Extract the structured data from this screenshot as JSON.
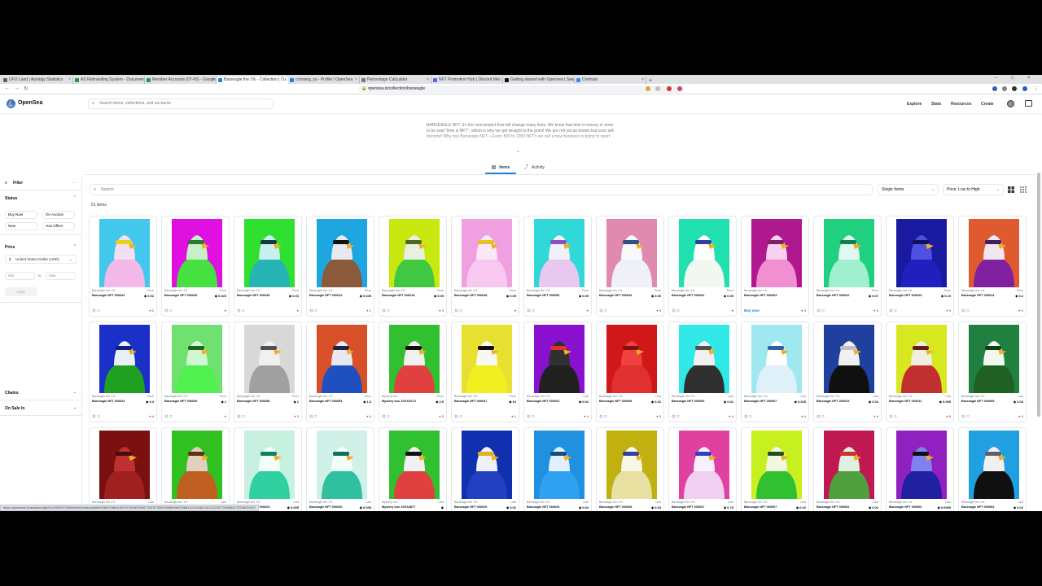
{
  "browser": {
    "tabs": [
      {
        "label": "UFO Land | Apology Statistics",
        "fav": "#5f6368"
      },
      {
        "label": "AS Rebranding System - Documentati...",
        "fav": "#3c8e3c"
      },
      {
        "label": "Member Accounts (07-#5) - Google ...",
        "fav": "#0f9d58"
      },
      {
        "label": "Barseagle the 1% - Collection | O...",
        "fav": "#2081e2",
        "active": true
      },
      {
        "label": "crossing_xx - Profile | OpenSea",
        "fav": "#2081e2"
      },
      {
        "label": "Percentage Calculator",
        "fav": "#777777"
      },
      {
        "label": "NFT Promotion Hub | Discord Me...",
        "fav": "#5865f2"
      },
      {
        "label": "Getting started with Opensea | Sea...",
        "fav": "#111111"
      },
      {
        "label": "Contrast",
        "fav": "#4285f4"
      }
    ],
    "new_tab": "+",
    "url": "opensea.io/collection/barseagle",
    "status_url": "https://opensea.io/assets/matic/0x2953397248fcbb4fe0cbaca8a0fcf0384f7486b1/557572648735617281573592389806980786814231638218121133077540680175756229017"
  },
  "header": {
    "logo": "OpenSea",
    "search_placeholder": "Search items, collections, and accounts",
    "nav": [
      "Explore",
      "Stats",
      "Resources",
      "Create"
    ]
  },
  "collection": {
    "description": "BARSEAGLE NFT, it's the next project that will change many lives. We know that time is money or soon to be said \"time is NFT\", which is why we get straight to the point! We are not yet as known but soon will become! Why buy Barseagle NFT: • Every 500 to 1000 NFT's we sell a new business is going to open! Let the future it down, let's say you want to open your own business, if you",
    "expand": "⌄"
  },
  "view_tabs": {
    "items": "Items",
    "activity": "Activity"
  },
  "sidebar": {
    "filter": "Filter",
    "collapse": "←",
    "status": "Status",
    "status_chips": [
      "Buy Now",
      "On Auction",
      "New",
      "Has Offers"
    ],
    "price": "Price",
    "currency": "United States Dollar (USD)",
    "min": "Min",
    "to": "to",
    "max": "Max",
    "apply": "Apply",
    "chains": "Chains",
    "on_sale_in": "On Sale In"
  },
  "toolbar": {
    "search_placeholder": "Search",
    "single_items": "Single Items",
    "sort": "Price: Low to High",
    "count": "51 items"
  },
  "cards": [
    {
      "name": "Barseagle the 1%",
      "token": "Barseagle NFT 000042",
      "plabel": "Price",
      "price": "0.02",
      "favs": "2",
      "bg": "#42c8ec",
      "body": "#f2b8e8",
      "head": "#f0e0f0",
      "accent": "#e8d020"
    },
    {
      "name": "Barseagle the 1%",
      "token": "Barseagle NFT 000046",
      "plabel": "Price",
      "price": "0.025",
      "favs": "",
      "bg": "#e010e0",
      "body": "#46e040",
      "head": "#c8f0c8",
      "accent": "#2a7a2a"
    },
    {
      "name": "Barseagle the 1%",
      "token": "Barseagle NFT 000045",
      "plabel": "Price",
      "price": "0.03",
      "favs": "",
      "bg": "#30e030",
      "body": "#26b4b4",
      "head": "#c8f0f0",
      "accent": "#1a3a3a"
    },
    {
      "name": "Barseagle the 1%",
      "token": "Barseagle NFT 000012",
      "plabel": "Price",
      "price": "0.045",
      "favs": "1",
      "bg": "#1ea6e0",
      "body": "#8a5a3a",
      "head": "#e8e8f0",
      "accent": "#111111"
    },
    {
      "name": "Barseagle the 1%",
      "token": "Barseagle NFT 000018",
      "plabel": "Price",
      "price": "0.05",
      "favs": "3",
      "bg": "#c8e810",
      "body": "#40c840",
      "head": "#e8f0e0",
      "accent": "#4a6a20"
    },
    {
      "name": "Barseagle the 1%",
      "token": "Barseagle NFT 000048",
      "plabel": "Price",
      "price": "0.05",
      "favs": "",
      "bg": "#f0a0e0",
      "body": "#f8c8f0",
      "head": "#f8e8f8",
      "accent": "#e8c020"
    },
    {
      "name": "Barseagle the 1%",
      "token": "Barseagle NFT 000050",
      "plabel": "Price",
      "price": "0.05",
      "favs": "",
      "bg": "#30d8d8",
      "body": "#e8c8f0",
      "head": "#f0f0f8",
      "accent": "#8a50c0"
    },
    {
      "name": "Barseagle the 1%",
      "token": "Barseagle NFT 000049",
      "plabel": "Price",
      "price": "0.05",
      "favs": "3",
      "bg": "#e08ab0",
      "body": "#f0f0f8",
      "head": "#f8f8ff",
      "accent": "#305080"
    },
    {
      "name": "Barseagle the 1%",
      "token": "Barseagle NFT 000051",
      "plabel": "Price",
      "price": "0.05",
      "favs": "",
      "bg": "#20e0b0",
      "body": "#f0f8f0",
      "head": "#ffffff",
      "accent": "#3040a0"
    },
    {
      "name": "Barseagle the 1%",
      "token": "Barseagle NFT 000003",
      "plabel": "",
      "price": "",
      "favs": "3",
      "bg": "#b01890",
      "body": "#f090d0",
      "head": "#f8d0f0",
      "accent": "#802060",
      "buy": "Buy now"
    },
    {
      "name": "Barseagle the 1%",
      "token": "Barseagle NFT 000022",
      "plabel": "Price",
      "price": "0.07",
      "favs": "3",
      "bg": "#20d080",
      "body": "#a0f0d0",
      "head": "#e0f8f0",
      "accent": "#108050"
    },
    {
      "name": "Barseagle the 1%",
      "token": "Barseagle NFT 000023",
      "plabel": "Price",
      "price": "0.19",
      "favs": "3",
      "bg": "#1a1aa0",
      "body": "#2020c0",
      "head": "#5050e0",
      "accent": "#101060"
    },
    {
      "name": "Barseagle the 1%",
      "token": "Barseagle NFT 000014",
      "plabel": "Price",
      "price": "0.2",
      "favs": "4",
      "bg": "#e05a30",
      "body": "#8020a0",
      "head": "#f0e8f0",
      "accent": "#402060"
    },
    {
      "name": "Barseagle the 1%",
      "token": "Barseagle NFT 000023",
      "plabel": "Price",
      "price": "0.3",
      "favs": "4",
      "bg": "#1a30c8",
      "body": "#20a020",
      "head": "#e8f0f8",
      "accent": "#102080"
    },
    {
      "name": "Barseagle the 1%",
      "token": "Barseagle NFT 000006",
      "plabel": "Price",
      "price": "1",
      "favs": "",
      "bg": "#70e070",
      "body": "#50f050",
      "head": "#d0f8d0",
      "accent": "#206020"
    },
    {
      "name": "Barseagle the 1%",
      "token": "Barseagle NFT 000058",
      "plabel": "Price",
      "price": "1",
      "favs": "3",
      "bg": "#d8d8d8",
      "body": "#a0a0a0",
      "head": "#f0f0f0",
      "accent": "#505050"
    },
    {
      "name": "Barseagle the 1%",
      "token": "Barseagle NFT 000053",
      "plabel": "Price",
      "price": "1.3",
      "favs": "4",
      "bg": "#d85028",
      "body": "#2050c0",
      "head": "#e8e8f0",
      "accent": "#202040"
    },
    {
      "name": "Mystery box",
      "token": "Mystery box XX2X2X73",
      "plabel": "Price",
      "price": "2.5",
      "favs": "3",
      "bg": "#30c030",
      "body": "#e04040",
      "head": "#f0f0f0",
      "accent": "#101010"
    },
    {
      "name": "Barseagle the 1%",
      "token": "Barseagle NFT 000047",
      "plabel": "Price",
      "price": "10",
      "favs": "1",
      "bg": "#e8e030",
      "body": "#f0f020",
      "head": "#f8f8f0",
      "accent": "#101010"
    },
    {
      "name": "Barseagle the 1%",
      "token": "Barseagle NFT 000002",
      "plabel": "Last",
      "price": "0.02",
      "favs": "4",
      "bg": "#8a10d0",
      "body": "#202020",
      "head": "#303030",
      "accent": "#e03030"
    },
    {
      "name": "Barseagle the 1%",
      "token": "Barseagle NFT 000008",
      "plabel": "Last",
      "price": "0.16",
      "favs": "3",
      "bg": "#d01818",
      "body": "#e03030",
      "head": "#f04040",
      "accent": "#801010"
    },
    {
      "name": "Barseagle the 1%",
      "token": "Barseagle NFT 000009",
      "plabel": "Last",
      "price": "0.02",
      "favs": "4",
      "bg": "#30e8e8",
      "body": "#303030",
      "head": "#f0f0f0",
      "accent": "#505050"
    },
    {
      "name": "Barseagle the 1%",
      "token": "Barseagle NFT 000007",
      "plabel": "Last",
      "price": "0.025",
      "favs": "4",
      "bg": "#a0e8f0",
      "body": "#e0f0f8",
      "head": "#ffffff",
      "accent": "#3060a0"
    },
    {
      "name": "Barseagle the 1%",
      "token": "Barseagle NFT 000019",
      "plabel": "Last",
      "price": "0.03",
      "favs": "4",
      "bg": "#2040a0",
      "body": "#101010",
      "head": "#f0f0f0",
      "accent": "#c0c0c0"
    },
    {
      "name": "Barseagle the 1%",
      "token": "Barseagle NFT 000011",
      "plabel": "Last",
      "price": "0.095",
      "favs": "5",
      "bg": "#d8e820",
      "body": "#c03030",
      "head": "#f0f0e0",
      "accent": "#602020"
    },
    {
      "name": "Barseagle the 1%",
      "token": "Barseagle NFT 000005",
      "plabel": "Last",
      "price": "0.03",
      "favs": "4",
      "bg": "#208040",
      "body": "#206020",
      "head": "#f0f8f0",
      "accent": "#104010"
    },
    {
      "name": "Barseagle the 1%",
      "token": "Barseagle NFT 000029",
      "plabel": "Last",
      "price": "",
      "favs": "",
      "bg": "#7a1010",
      "body": "#a02020",
      "head": "#c03030",
      "accent": "#401010"
    },
    {
      "name": "Barseagle the 1%",
      "token": "Barseagle NFT 000031",
      "plabel": "Last",
      "price": "0.02",
      "favs": "",
      "bg": "#30c020",
      "body": "#c06020",
      "head": "#e0d0c0",
      "accent": "#603010"
    },
    {
      "name": "Barseagle the 1%",
      "token": "Barseagle NFT 000024",
      "plabel": "Last",
      "price": "0.035",
      "favs": "",
      "bg": "#c8f0e0",
      "body": "#30d0a0",
      "head": "#f0fff8",
      "accent": "#108060"
    },
    {
      "name": "Barseagle the 1%",
      "token": "Barseagle NFT 000020",
      "plabel": "Last",
      "price": "0.035",
      "favs": "",
      "bg": "#d0f0e8",
      "body": "#30c0a0",
      "head": "#f0fff8",
      "accent": "#107060"
    },
    {
      "name": "Mystery box",
      "token": "Mystery box XX2X4877",
      "plabel": "Last",
      "price": "",
      "favs": "",
      "bg": "#30c030",
      "body": "#e04040",
      "head": "#f0f0f0",
      "accent": "#101010"
    },
    {
      "name": "Barseagle the 1%",
      "token": "Barseagle NFT 000025",
      "plabel": "Last",
      "price": "0.02",
      "favs": "",
      "bg": "#1030b0",
      "body": "#2040c0",
      "head": "#f0f0f8",
      "accent": "#e0b020"
    },
    {
      "name": "Barseagle the 1%",
      "token": "Barseagle NFT 000029",
      "plabel": "Last",
      "price": "0.03",
      "favs": "",
      "bg": "#2090e0",
      "body": "#30a0f0",
      "head": "#e0f0ff",
      "accent": "#105080"
    },
    {
      "name": "Barseagle the 1%",
      "token": "Barseagle NFT 000028",
      "plabel": "Last",
      "price": "0.03",
      "favs": "",
      "bg": "#c0b010",
      "body": "#e8e0a0",
      "head": "#f8f8e8",
      "accent": "#3040a0"
    },
    {
      "name": "Barseagle the 1%",
      "token": "Barseagle NFT 000037",
      "plabel": "Last",
      "price": "0.75",
      "favs": "",
      "bg": "#e040a0",
      "body": "#f0d0f0",
      "head": "#f8f0ff",
      "accent": "#3040c0"
    },
    {
      "name": "Barseagle the 1%",
      "token": "Barseagle NFT 000007",
      "plabel": "Last",
      "price": "0.02",
      "favs": "",
      "bg": "#c8f020",
      "body": "#30c030",
      "head": "#f0f8e0",
      "accent": "#205020"
    },
    {
      "name": "Barseagle the 1%",
      "token": "Barseagle NFT 000081",
      "plabel": "Last",
      "price": "0.02",
      "favs": "",
      "bg": "#c01850",
      "body": "#50a040",
      "head": "#e0f0e0",
      "accent": "#d03030"
    },
    {
      "name": "Barseagle the 1%",
      "token": "Barseagle NFT 000003",
      "plabel": "Last",
      "price": "0.0095",
      "favs": "",
      "bg": "#9020c0",
      "body": "#2020a0",
      "head": "#8080f0",
      "accent": "#101010"
    },
    {
      "name": "Barseagle the 1%",
      "token": "Barseagle NFT 000004",
      "plabel": "Last",
      "price": "0.02",
      "favs": "",
      "bg": "#20a0e0",
      "body": "#101010",
      "head": "#f0f0f0",
      "accent": "#606060"
    }
  ]
}
